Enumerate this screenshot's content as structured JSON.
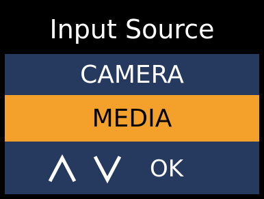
{
  "screen": {
    "title": "Input Source",
    "options": [
      "CAMERA",
      "MEDIA"
    ],
    "selected": "MEDIA",
    "controls": {
      "up_icon": "caret-up-icon",
      "down_icon": "caret-down-icon",
      "ok_label": "OK"
    },
    "colors": {
      "background": "#253a5e",
      "title_bar": "#000000",
      "selected_row": "#f4a12b"
    }
  }
}
